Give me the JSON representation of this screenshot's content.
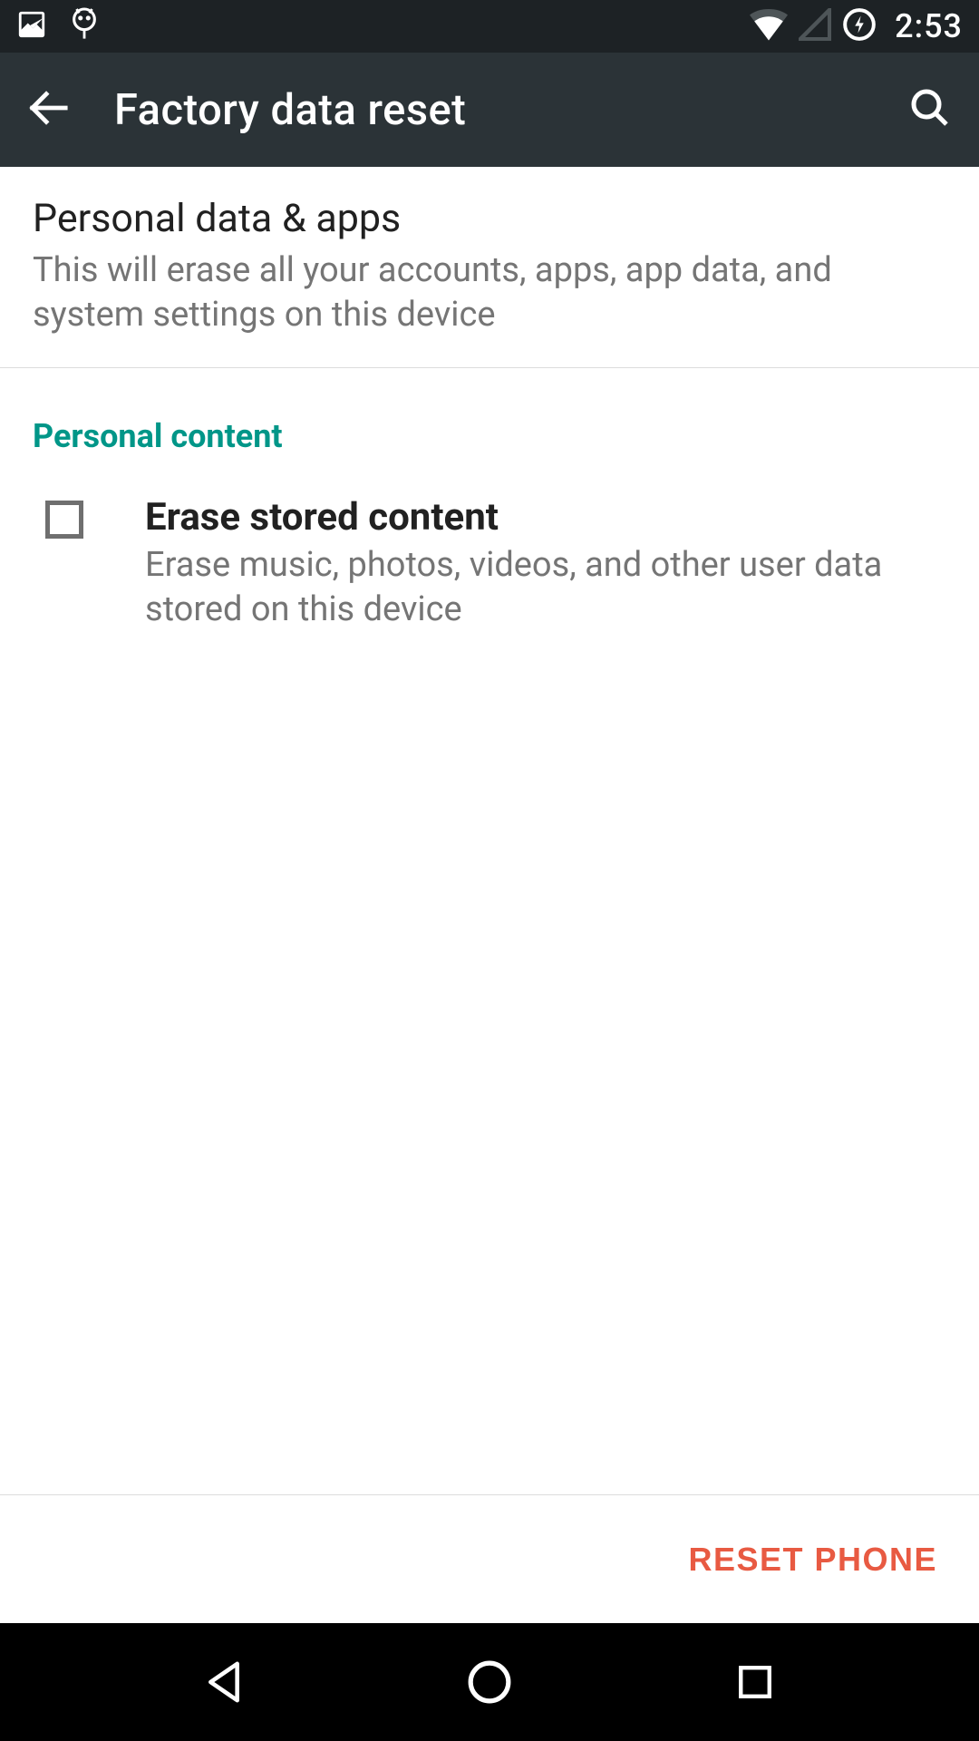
{
  "status_bar": {
    "time": "2:53"
  },
  "app_bar": {
    "title": "Factory data reset"
  },
  "section1": {
    "title": "Personal data & apps",
    "description": "This will erase all your accounts, apps, app data, and system settings on this device"
  },
  "section2": {
    "label": "Personal content",
    "checkbox": {
      "title": "Erase stored content",
      "description": "Erase music, photos, videos, and other user data stored on this device",
      "checked": false
    }
  },
  "footer": {
    "reset_label": "RESET PHONE"
  }
}
